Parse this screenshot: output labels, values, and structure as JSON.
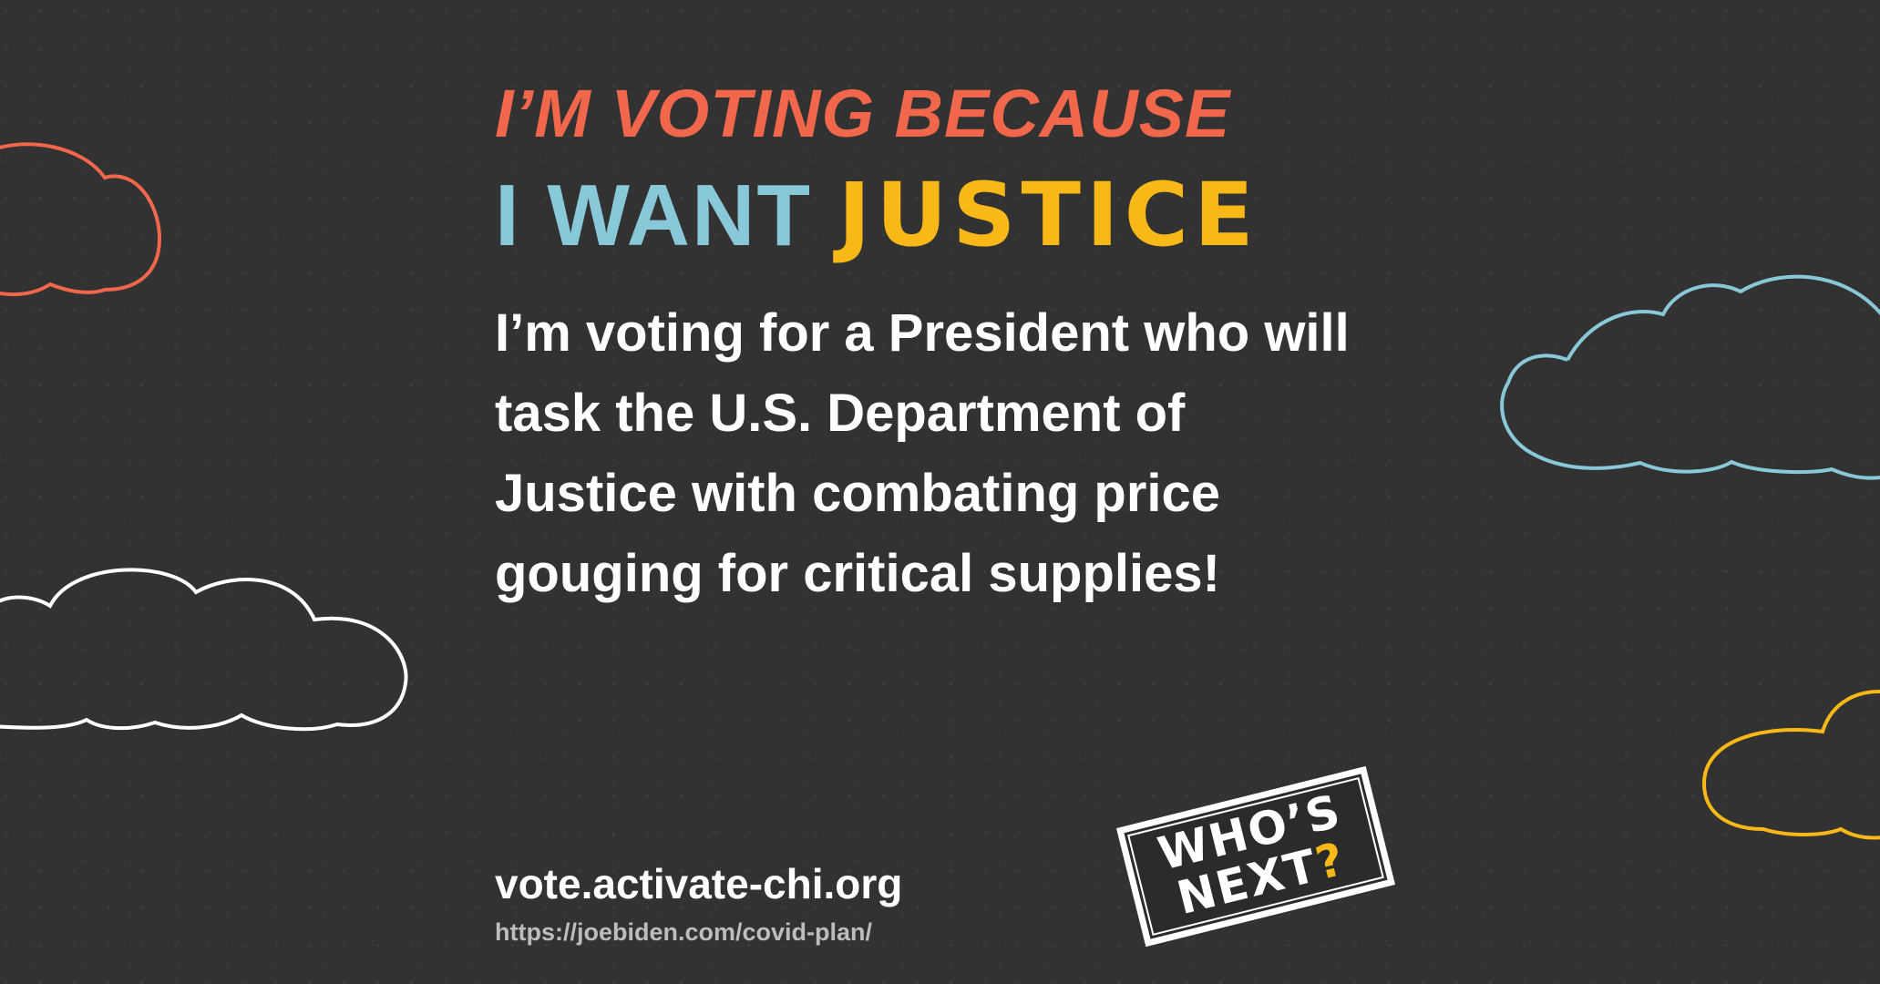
{
  "header": {
    "kicker": "I’M VOTING BECAUSE",
    "headline_part1": "I WANT",
    "headline_part2": "JUSTICE"
  },
  "body": {
    "lines": [
      "I’m voting for a President who will",
      "task the U.S. Department of",
      "Justice with combating price",
      "gouging for critical supplies!"
    ]
  },
  "footer": {
    "website": "vote.activate-chi.org",
    "source_url": "https://joebiden.com/covid-plan/"
  },
  "badge": {
    "line1": "WHO’S",
    "line2_text": "NEXT",
    "line2_mark": "?"
  },
  "colors": {
    "background": "#323232",
    "kicker": "#f0674b",
    "headline_blue": "#89c8d8",
    "headline_yellow": "#f8b818",
    "body_text": "#ffffff",
    "source_text": "#bdbdbd"
  }
}
